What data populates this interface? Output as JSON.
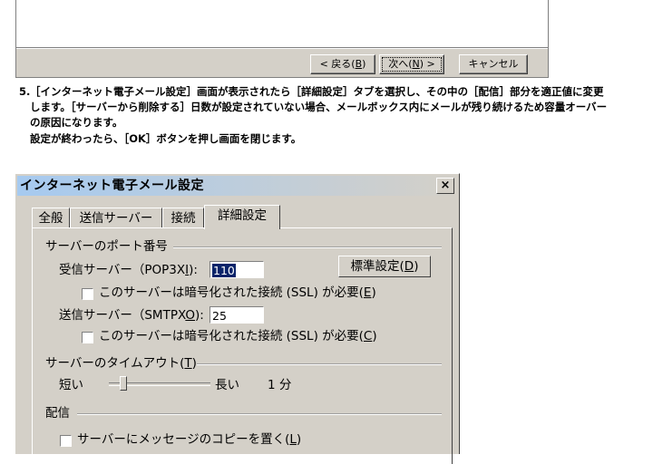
{
  "wizard": {
    "back_label": "< 戻る(",
    "back_key": "B",
    "back_end": ")",
    "next_label": "次へ(",
    "next_key": "N",
    "next_end": ") >",
    "cancel_label": "キャンセル"
  },
  "instructions": {
    "step_number": "5.",
    "line1": "［インターネット電子メール設定］画面が表示されたら［詳細設定］タブを選択し、その中の［配信］部分を適正値に変更",
    "line2": "します。［サーバーから削除する］日数が設定されていない場合、メールボックス内にメールが残り続けるため容量オーバー",
    "line3": "の原因になります。",
    "line4": "設定が終わったら、［OK］ボタンを押し画面を閉じます。"
  },
  "dialog": {
    "title": "インターネット電子メール設定",
    "close_glyph": "×",
    "tabs": [
      {
        "label": "全般"
      },
      {
        "label": "送信サーバー"
      },
      {
        "label": "接続"
      },
      {
        "label": "詳細設定"
      }
    ],
    "ports": {
      "group_label": "サーバーのポート番号",
      "incoming_label": "受信サーバー（POP3X",
      "incoming_key": "I",
      "incoming_end": "):",
      "incoming_value": "110",
      "default_button": "標準設定(",
      "default_key": "D",
      "default_end": ")",
      "ssl_in_label": "このサーバーは暗号化された接続 (SSL) が必要(",
      "ssl_in_key": "E",
      "ssl_in_end": ")",
      "outgoing_label": "送信サーバー（SMTPX",
      "outgoing_key": "O",
      "outgoing_end": "):",
      "outgoing_value": "25",
      "ssl_out_label": "このサーバーは暗号化された接続 (SSL) が必要(",
      "ssl_out_key": "C",
      "ssl_out_end": ")"
    },
    "timeout": {
      "group_label": "サーバーのタイムアウト(",
      "group_key": "T",
      "group_end": ")",
      "short_label": "短い",
      "long_label": "長い",
      "value_text": "1 分",
      "level": 0.12
    },
    "delivery": {
      "group_label": "配信",
      "leave_copy_label": "サーバーにメッセージのコピーを置く(",
      "leave_copy_key": "L",
      "leave_copy_end": ")"
    }
  }
}
